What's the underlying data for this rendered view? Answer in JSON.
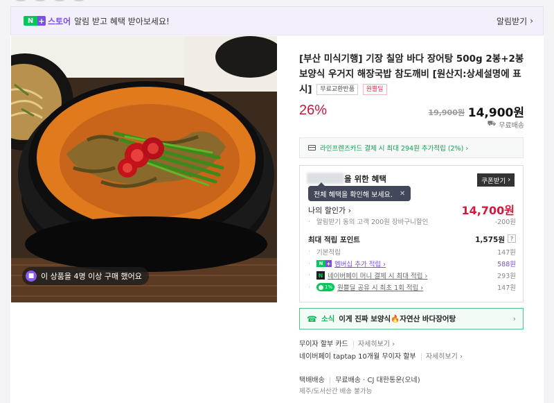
{
  "banner": {
    "logo_n": "N",
    "logo_plus": "+",
    "store_label": "스토어",
    "message": "알림 받고 혜택 받아보세요!",
    "notify_button": "알림받기",
    "chevron": "›"
  },
  "photo": {
    "alt": "장어탕 뚝배기",
    "buyer_badge": "이 상품을 4명 이상 구매 했어요"
  },
  "product": {
    "title": "[부산 미식기행] 기장 칠암 바다 장어탕 500g 2봉+2봉 보양식 우거지 해장국밥 참도깨비 [원산지:상세설명에 표시]",
    "tags": [
      "무료교환반품",
      "원쁠딜"
    ],
    "discount": "26%",
    "original_price": "19,900원",
    "final_price": "14,900원",
    "shipping": "무료배송"
  },
  "card_promo": {
    "text": "라인프렌즈카드 결제 시 최대 294원 추가적립 (2%) ›"
  },
  "benefit": {
    "header_suffix": "을 위한 혜택",
    "coupon_button": "쿠폰받기",
    "tooltip": "전체 혜택을 확인해 보세요.",
    "tooltip_close": "✕",
    "my_price_label": "나의 할인가 ›",
    "my_price": "14,700원",
    "alarm_discount_label": "알림받기 동의 고객 200원 장바구니할인",
    "alarm_discount_value": "-200원",
    "points_label": "최대 적립 포인트",
    "points_value": "1,575원",
    "points_help": "?",
    "rows": [
      {
        "label": "기본적립",
        "value": "147원"
      },
      {
        "label": "멤버십 추가 적립 ›",
        "value": "588원"
      },
      {
        "label": "네이버페이 머니 결제 시 최대 적립 ›",
        "value": "293원"
      },
      {
        "label": "원쁠딜 공유 시 최초 1회 적립 ›",
        "value": "147원"
      }
    ],
    "pct_badge": "1%",
    "npay_mark": "N"
  },
  "news": {
    "label": "소식",
    "text": "이게 진짜 보양식🔥자연산 바다장어탕",
    "chevron": "›"
  },
  "payments": [
    {
      "label": "무이자 할부 카드",
      "more": "자세히보기 ›"
    },
    {
      "label": "네이버페이 taptap 10개월 무이자 할부",
      "more": "자세히보기 ›"
    }
  ],
  "delivery": {
    "type": "택배배송",
    "fee": "무료배송 · CJ 대한통운(오네)",
    "note": "제주/도서산간 배송 불가능"
  },
  "colors": {
    "naver_green": "#03c75a",
    "plus_purple": "#7b4ee5",
    "discount_red": "#c3183b"
  }
}
